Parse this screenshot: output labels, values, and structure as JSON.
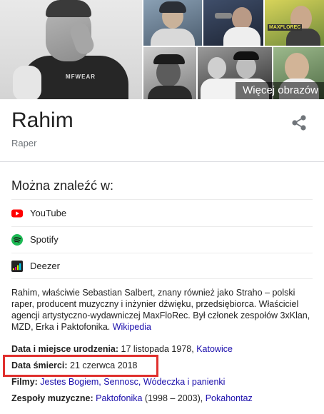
{
  "images": {
    "more_images_label": "Więcej obrazów",
    "main_photo_brand": "MFWEAR",
    "thumb_sign": "MAXFLOREC"
  },
  "entity": {
    "title": "Rahim",
    "subtitle": "Raper"
  },
  "profiles": {
    "heading": "Można znaleźć w:",
    "items": [
      {
        "label": "YouTube",
        "icon": "youtube-icon",
        "color": "#ff0000"
      },
      {
        "label": "Spotify",
        "icon": "spotify-icon",
        "color": "#1db954"
      },
      {
        "label": "Deezer",
        "icon": "deezer-icon",
        "color": "#222222"
      }
    ]
  },
  "description": {
    "text": "Rahim, właściwie Sebastian Salbert, znany również jako Straho – polski raper, producent muzyczny i inżynier dźwięku, przedsiębiorca. Właściciel agencji artystyczno-wydawniczej MaxFloRec. Był członek zespołów 3xKlan, MZD, Erka i Paktofonika.",
    "source_link": "Wikipedia"
  },
  "facts": {
    "birth_label": "Data i miejsce urodzenia:",
    "birth_value": "17 listopada 1978,",
    "birth_place": "Katowice",
    "death_label": "Data śmierci:",
    "death_value": "21 czerwca 2018",
    "films_label": "Filmy:",
    "films_value": "Jestes Bogiem, Sennosc, Wódeczka i panienki",
    "bands_label": "Zespoły muzyczne:",
    "band_1": "Paktofonika",
    "band_1_years": "(1998 – 2003),",
    "band_2": "Pokahontaz"
  },
  "colors": {
    "link": "#1a0dab",
    "highlight": "#e0302e",
    "muted": "#70757a"
  }
}
